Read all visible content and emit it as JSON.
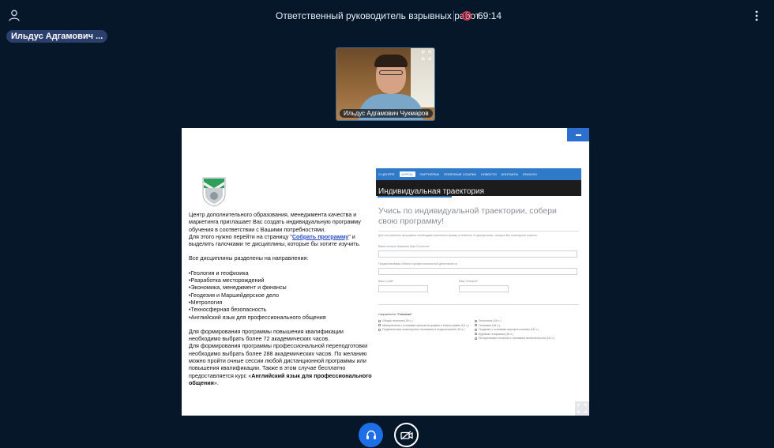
{
  "header": {
    "title": "Ответственный руководитель взрывных работ",
    "timer": "69:14"
  },
  "presenter": {
    "name": "Ильдус Адгамович ..."
  },
  "video": {
    "name": "Ильдус Адгамович Чукмаров"
  },
  "slide": {
    "left": {
      "intro": "Центр дополнительного образования, менеджмента качества и маркетинга приглашает Вас создать индивидуальную программу обучения в соответствии с Вашими потребностями.",
      "link_prefix": "Для этого нужно перейти на страницу \"",
      "link_text": "Собрать программу",
      "link_suffix": "\" и выделить галочками те дисциплины, которые бы хотите изучить.",
      "directions_heading": "Все дисциплины разделены на направления:",
      "directions": [
        "•Геология и геофизика",
        "•Разработка месторождений",
        "•Экономика, менеджмент и финансы",
        "•Геодезия и Маршейдерское дело",
        "•Метрология",
        "•Техносферная безопасность",
        "•Английский язык для профессионального общения"
      ],
      "qualification": "Для формирования программы повышения квалификации необходимо выбрать более 72 академических часов.",
      "retraining_prefix": "Для формирования программы профессиональной переподготовки необходимо выбрать более 288 академических часов. По желанию можно пройти очные сессии любой дистанционной программы или повышения квалификации. Также в этом случае бесплатно предоставляется курс «",
      "retraining_course": "Английский язык для профессионального общения",
      "retraining_suffix": "»."
    },
    "web": {
      "nav": [
        "О ЦЕНТРЕ",
        "КУРСЫ",
        "ПАРТНЕРАМ",
        "ПОЛЕЗНЫЕ ССЫЛКИ",
        "НОВОСТИ",
        "КОНТАКТЫ",
        "ENGLISH"
      ],
      "banner": "Индивидуальная траектория",
      "heading": "Учись по индивидуальной траектории, собери свою программу!",
      "desc": "Для составления программы необходимо заполнить форму и отметить те дисциплины, которые Вы планируете изучить.",
      "field_name": "Ваши полные Фамилия Имя Отчество*",
      "field_area": "Предполагаемая область профессиональной деятельности",
      "field_email": "Ваш e-mail*",
      "field_phone": "Ваш телефон*",
      "direction_prefix": "Направление ",
      "direction_name": "\"Геология\"",
      "checks_left": [
        "Общая геология (18 ч.)",
        "Минералогия с основами кристаллографии и петрографии (18 ч.)",
        "Геодезические инженерные изыскания в геодезической (18 ч.)"
      ],
      "checks_right": [
        "Литология (18 ч.)",
        "Геохимия (18 ч.)",
        "Геодезия с основами аэрофотосъемки (18 ч.)",
        "Буровые геофизика (18 ч.)",
        "Исторические геология с основами палеонтологии (18 ч.)"
      ],
      "more": "..."
    }
  }
}
